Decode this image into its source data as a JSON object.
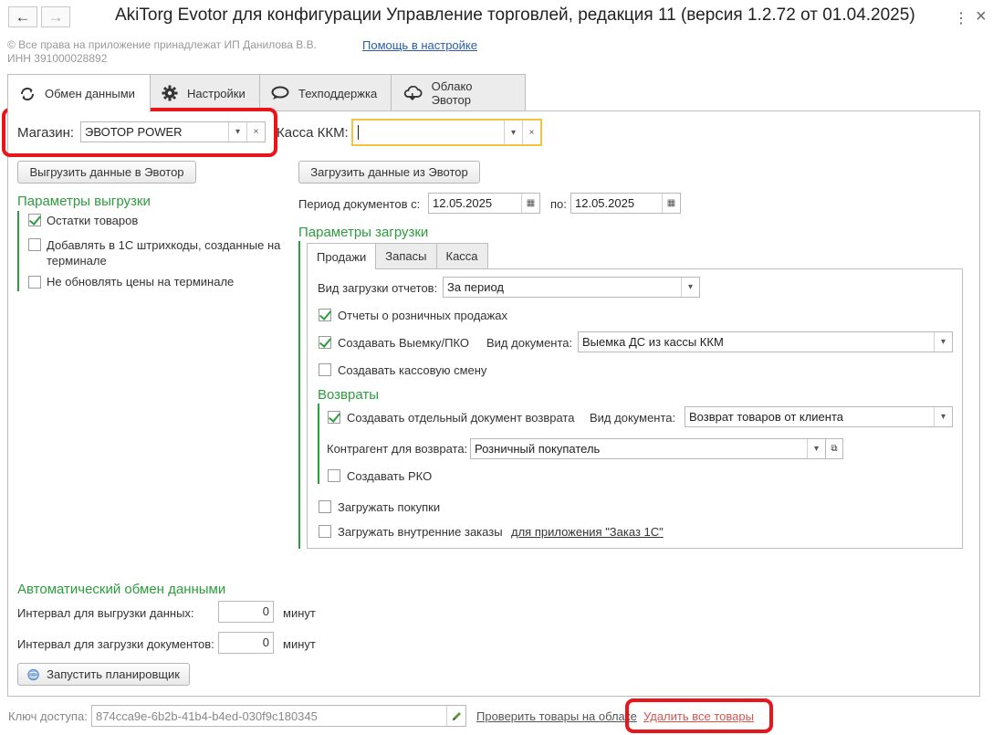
{
  "window": {
    "title": "AkiTorg Evotor для конфигурации Управление торговлей, редакция 11 (версия 1.2.72 от 01.04.2025)",
    "back_icon": "←",
    "forward_icon": "→",
    "menu_icon": "⋮",
    "close_icon": "×"
  },
  "header": {
    "copyright": "© Все права на приложение принадлежат ИП Данилова В.В.",
    "inn": "ИНН 391000028892",
    "help_link": "Помощь в настройке"
  },
  "tabs": [
    {
      "label": "Обмен данными",
      "icon": "sync-icon"
    },
    {
      "label": "Настройки",
      "icon": "gear-icon"
    },
    {
      "label": "Техподдержка",
      "icon": "chat-icon"
    },
    {
      "label": "Облако Эвотор",
      "icon": "cloud-icon"
    }
  ],
  "store": {
    "label": "Магазин:",
    "value": "ЭВОТОР POWER"
  },
  "kkm": {
    "label": "Касса ККМ:",
    "value": ""
  },
  "export_button": "Выгрузить данные в Эвотор",
  "import_button": "Загрузить данные из Эвотор",
  "export_params": {
    "title": "Параметры выгрузки",
    "items": [
      {
        "label": "Остатки товаров",
        "checked": true
      },
      {
        "label": "Добавлять в 1С штрихкоды, созданные на",
        "label2": "терминале",
        "checked": false
      },
      {
        "label": "Не обновлять цены на терминале",
        "checked": false
      }
    ]
  },
  "period": {
    "label": "Период  документов с:",
    "from": "12.05.2025",
    "to_label": "по:",
    "to": "12.05.2025"
  },
  "import_params": {
    "title": "Параметры загрузки",
    "subtabs": [
      "Продажи",
      "Запасы",
      "Касса"
    ],
    "report_type_label": "Вид загрузки отчетов:",
    "report_type_value": "За период",
    "retail_reports": {
      "label": "Отчеты о розничных продажах",
      "checked": true
    },
    "withdrawal": {
      "label": "Создавать Выемку/ПКО",
      "checked": true
    },
    "doc_type_label": "Вид документа:",
    "doc_type_value": "Выемка ДС из кассы ККМ",
    "cash_shift": {
      "label": "Создавать кассовую смену",
      "checked": false
    },
    "returns_title": "Возвраты",
    "separate_return": {
      "label": "Создавать отдельный документ возврата",
      "checked": true
    },
    "return_doc_label": "Вид  документа:",
    "return_doc_value": "Возврат товаров от клиента",
    "counterparty_label": "Контрагент для возврата:",
    "counterparty_value": "Розничный покупатель",
    "create_rko": {
      "label": "Создавать РКО",
      "checked": false
    },
    "load_purchases": {
      "label": "Загружать покупки",
      "checked": false
    },
    "load_orders": {
      "label": "Загружать внутренние заказы",
      "checked": false
    },
    "orders_link": "для приложения \"Заказ 1С\""
  },
  "auto_exchange": {
    "title": "Автоматический обмен данными",
    "export_interval_label": "Интервал для выгрузки данных:",
    "export_interval": "0",
    "import_interval_label": "Интервал для загрузки документов:",
    "import_interval": "0",
    "unit": "минут",
    "scheduler_button": "Запустить планировщик"
  },
  "footer": {
    "key_label": "Ключ доступа:",
    "key_value": "874cca9e-6b2b-41b4-b4ed-030f9c180345",
    "check_link": "Проверить товары на облаке",
    "delete_link": "Удалить все товары"
  },
  "colors": {
    "accent_green": "#2c9c3e",
    "highlight_red": "#e8151b",
    "link_blue": "#2a5ea8",
    "focus_yellow": "#f5c342"
  }
}
